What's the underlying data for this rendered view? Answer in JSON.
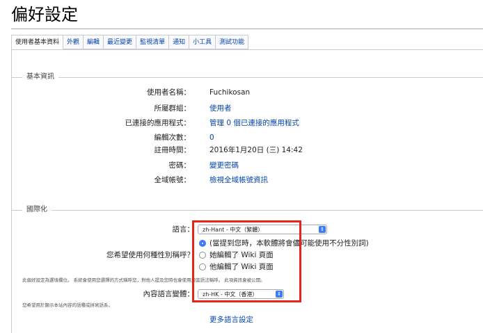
{
  "page": {
    "title": "偏好設定"
  },
  "tabs": [
    {
      "label": "使用者基本資料",
      "active": true
    },
    {
      "label": "外觀"
    },
    {
      "label": "編輯"
    },
    {
      "label": "最近變更"
    },
    {
      "label": "監視清單"
    },
    {
      "label": "通知"
    },
    {
      "label": "小工具"
    },
    {
      "label": "測試功能"
    }
  ],
  "basic": {
    "legend": "基本資訊",
    "username_label": "使用者名稱：",
    "username": "Fuchikosan",
    "groups_label": "所屬群組：",
    "groups": "使用者",
    "apps_label": "已連接的應用程式：",
    "apps": "管理 0 個已連接的應用程式",
    "edits_label": "編輯次數：",
    "edits": "0",
    "registered_label": "註冊時間：",
    "registered": "2016年1月20日 (三) 14:42",
    "password_label": "密碼：",
    "password": "變更密碼",
    "global_label": "全域帳號：",
    "global": "檢視全域帳號資訊"
  },
  "i18n": {
    "legend": "國際化",
    "language_label": "語言：",
    "language_value": "zh-Hant - 中文（繁體）",
    "gender_label": "您希望使用何種性別稱呼？",
    "gender_options": [
      "(當提到您時，本軟體將會儘可能使用不分性別詞)",
      "她編輯了 Wiki 頁面",
      "他編輯了 Wiki 頁面"
    ],
    "gender_note": "此偏好設定為選填欄位。 系統會使用您選擇的方式稱呼您，對他人提及您時也會使用適當語法稱呼。 此項資訊會被公開。",
    "variant_label": "內容語言變體：",
    "variant_value": "zh-HK - 中文（香港）",
    "variant_note": "您希望用於顯示本站內容的語種或拼寫語系。",
    "more_link": "更多語言設定"
  },
  "colors": {
    "link": "#0645ad",
    "highlight": "#e8231a",
    "select_accent": "#3e7bfa"
  }
}
